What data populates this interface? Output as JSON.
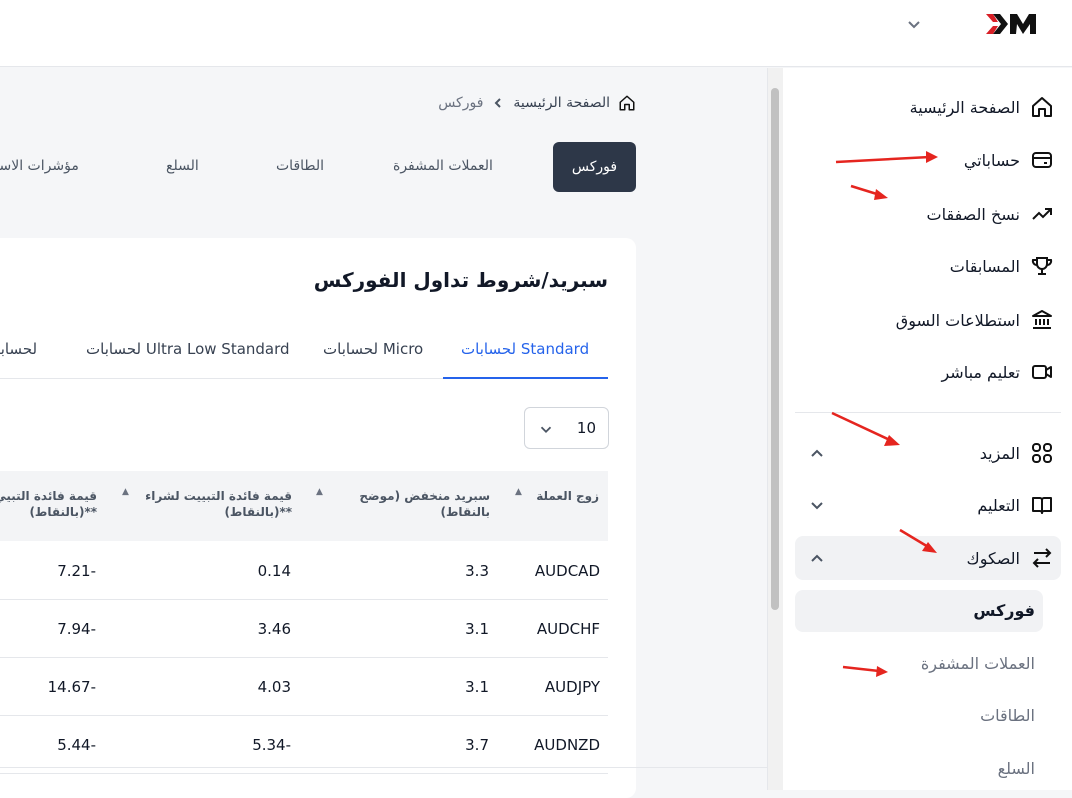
{
  "header": {
    "logo_x": "X",
    "logo_m": "M"
  },
  "sidebar": {
    "items": [
      {
        "label": "الصفحة الرئيسية",
        "icon": "home-icon"
      },
      {
        "label": "حساباتي",
        "icon": "wallet-icon"
      },
      {
        "label": "نسخ الصفقات",
        "icon": "trending-up-icon"
      },
      {
        "label": "المسابقات",
        "icon": "trophy-icon"
      },
      {
        "label": "استطلاعات السوق",
        "icon": "bank-icon"
      },
      {
        "label": "تعليم مباشر",
        "icon": "video-icon"
      }
    ],
    "groups": [
      {
        "label": "المزيد",
        "icon": "grid-icon",
        "expanded": true
      },
      {
        "label": "التعليم",
        "icon": "book-icon",
        "expanded": false
      },
      {
        "label": "الصكوك",
        "icon": "swap-icon",
        "expanded": true
      }
    ],
    "sub_items": [
      "فوركس",
      "العملات المشفرة",
      "الطاقات",
      "السلع"
    ]
  },
  "breadcrumb": {
    "home": "الصفحة الرئيسية",
    "current": "فوركس"
  },
  "categories": [
    "فوركس",
    "العملات المشفرة",
    "الطاقات",
    "السلع",
    "مؤشرات الاسه"
  ],
  "card": {
    "title": "سبريد/شروط تداول الفوركس",
    "account_tabs": [
      "لحسابات Standard",
      "لحسابات Micro",
      "لحسابات Ultra Low Standard",
      "لحسابات"
    ],
    "page_size": "10",
    "columns": [
      "زوج العملة",
      "سبريد منخفض (موضح بالنقاط)",
      "قيمة فائدة التبييت لشراء (بالنقاط)**",
      "قيمة فائدة التبيي (بالنقاط)**"
    ],
    "rows": [
      [
        "AUDCAD",
        "3.3",
        "0.14",
        "7.21-"
      ],
      [
        "AUDCHF",
        "3.1",
        "3.46",
        "7.94-"
      ],
      [
        "AUDJPY",
        "3.1",
        "4.03",
        "14.67-"
      ],
      [
        "AUDNZD",
        "3.7",
        "5.34-",
        "5.44-"
      ]
    ]
  },
  "colors": {
    "accent": "#2563eb",
    "dark_tab": "#2d3748",
    "annotation": "#e5251f"
  }
}
